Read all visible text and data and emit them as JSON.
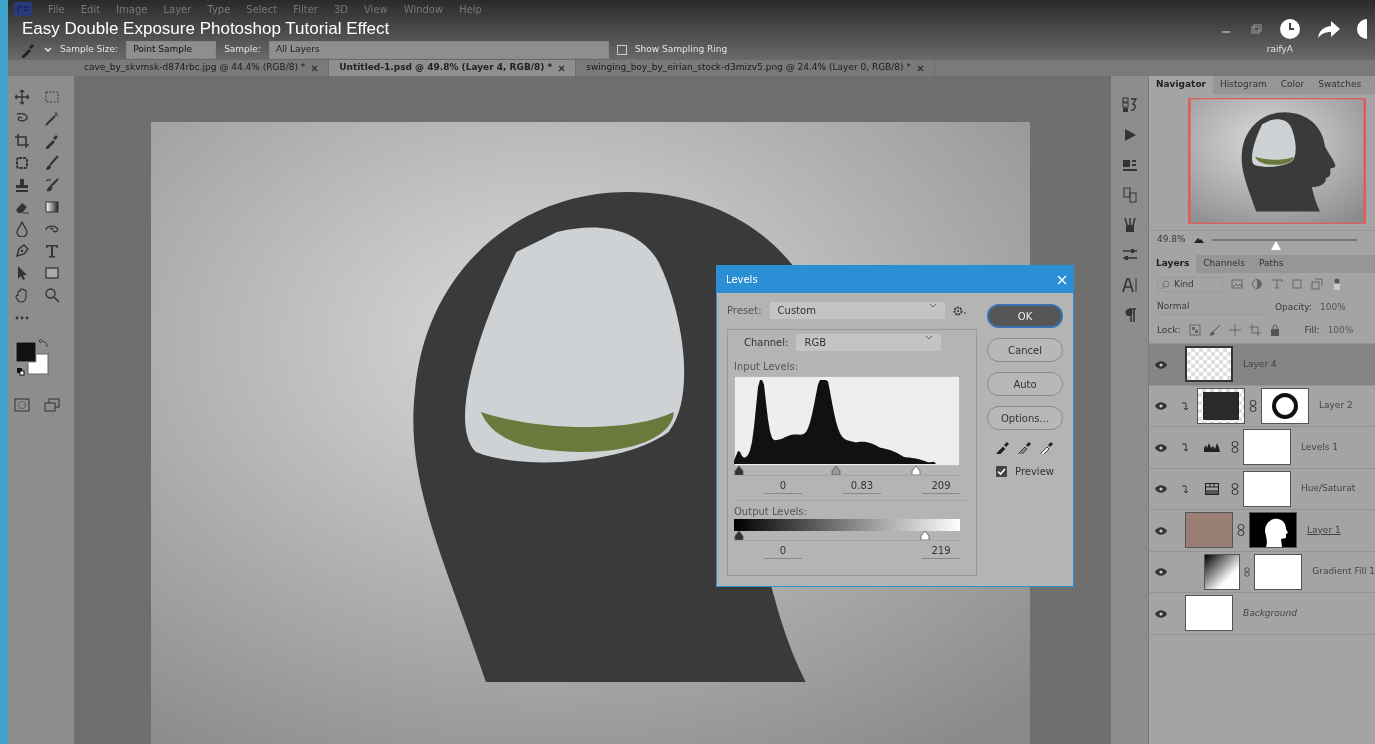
{
  "video": {
    "title": "Easy Double Exposure Photoshop Tutorial Effect"
  },
  "menu": [
    "File",
    "Edit",
    "Image",
    "Layer",
    "Type",
    "Select",
    "Filter",
    "3D",
    "View",
    "Window",
    "Help"
  ],
  "account": "raifyA",
  "options_bar": {
    "sample_size_label": "Sample Size:",
    "sample_size": "Point Sample",
    "sample_label": "Sample:",
    "sample": "All Layers",
    "sampling_ring": {
      "label": "Show Sampling Ring",
      "checked": false
    }
  },
  "document_tabs": [
    {
      "label": "cave_by_skvmsk-d874rbc.jpg @ 44.4% (RGB/8) *",
      "selected": false
    },
    {
      "label": "Untitled-1.psd @ 49.8% (Layer 4, RGB/8) *",
      "selected": true
    },
    {
      "label": "swinging_boy_by_eirian_stock-d3mizv5.png @ 24.4% (Layer 0, RGB/8) *",
      "selected": false
    }
  ],
  "levels_dialog": {
    "title": "Levels",
    "preset_label": "Preset:",
    "preset": "Custom",
    "channel_label": "Channel:",
    "channel": "RGB",
    "input_label": "Input Levels:",
    "input_handles": [
      {
        "level": 0
      },
      {
        "level": 0.45
      },
      {
        "level": 0.82
      }
    ],
    "input_values": [
      "0",
      "0.83",
      "209"
    ],
    "output_label": "Output Levels:",
    "output_handles": [
      {
        "level": 0
      },
      {
        "level": 0.86
      }
    ],
    "output_values": [
      "0",
      "219"
    ],
    "buttons": [
      {
        "label": "OK",
        "default": true
      },
      {
        "label": "Cancel",
        "default": false
      },
      {
        "label": "Auto",
        "default": false
      },
      {
        "label": "Options...",
        "default": false
      }
    ],
    "preview": {
      "label": "Preview",
      "checked": true
    }
  },
  "navigator": {
    "tabs": [
      {
        "label": "Navigator",
        "selected": true
      },
      {
        "label": "Histogram",
        "selected": false
      },
      {
        "label": "Color",
        "selected": false
      },
      {
        "label": "Swatches",
        "selected": false
      }
    ],
    "zoom": "49.8%",
    "level": 0.44
  },
  "layers_panel": {
    "tabs": [
      {
        "label": "Layers",
        "selected": true
      },
      {
        "label": "Channels",
        "selected": false
      },
      {
        "label": "Paths",
        "selected": false
      }
    ],
    "filter": "Kind",
    "blend_mode": "Normal",
    "opacity_label": "Opacity:",
    "opacity": "100%",
    "lock_label": "Lock:",
    "fill_label": "Fill:",
    "fill": "100%",
    "layers": [
      {
        "name": "Layer 4",
        "kind": "empty",
        "selected": true,
        "visible": true,
        "clipped": false
      },
      {
        "name": "Layer 2",
        "kind": "cave",
        "selected": false,
        "visible": true,
        "clipped": true
      },
      {
        "name": "Levels 1",
        "kind": "levels",
        "selected": false,
        "visible": true,
        "clipped": true
      },
      {
        "name": "Hue/Saturat",
        "kind": "hue_sat",
        "selected": false,
        "visible": true,
        "clipped": true
      },
      {
        "name": "Layer 1",
        "kind": "portrait",
        "selected": false,
        "visible": true,
        "clipped": false
      },
      {
        "name": "Gradient Fill 1",
        "kind": "gradient",
        "selected": false,
        "visible": true,
        "clipped": false
      },
      {
        "name": "Background",
        "kind": "background",
        "selected": false,
        "visible": true,
        "clipped": false
      }
    ]
  }
}
